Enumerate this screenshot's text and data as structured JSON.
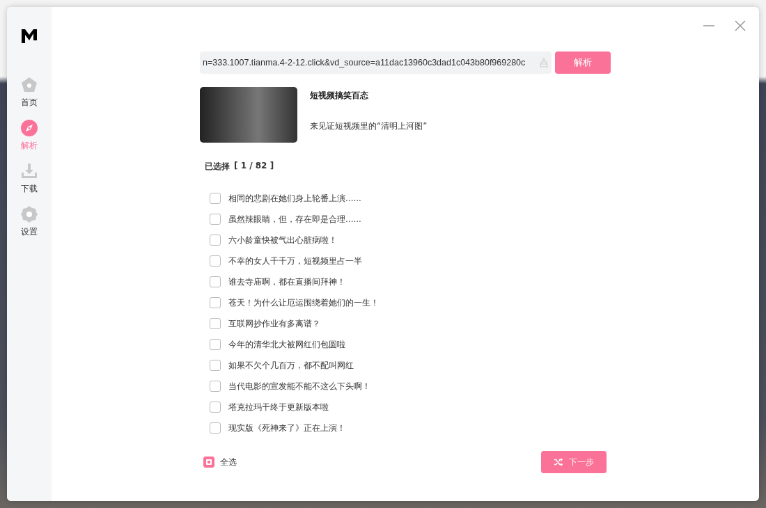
{
  "sidebar": {
    "items": [
      {
        "label": "首页",
        "kind": "home",
        "selected": false
      },
      {
        "label": "解析",
        "kind": "compass",
        "selected": true
      },
      {
        "label": "下载",
        "kind": "download",
        "selected": false
      },
      {
        "label": "设置",
        "kind": "gear",
        "selected": false
      }
    ]
  },
  "url_field": {
    "value": "n=333.1007.tianma.4-2-12.click&vd_source=a11dac13960c3dad1c043b80f969280c"
  },
  "parse_button": "解析",
  "video": {
    "title": "短视频搞笑百态",
    "description": "来见证短视频里的“清明上河图”"
  },
  "selection": {
    "label": "已选择",
    "count": "[ 1 / 82 ]"
  },
  "episodes": [
    {
      "title": "相同的悲剧在她们身上轮番上演......",
      "checked": false
    },
    {
      "title": "虽然辣眼睛，但，存在即是合理......",
      "checked": false
    },
    {
      "title": "六小龄童快被气出心脏病啦！",
      "checked": false
    },
    {
      "title": "不幸的女人千千万，短视频里占一半",
      "checked": false
    },
    {
      "title": "谁去寺庙啊，都在直播间拜神！",
      "checked": false
    },
    {
      "title": "苍天！为什么让厄运围绕着她们的一生！",
      "checked": false
    },
    {
      "title": "互联网抄作业有多离谱？",
      "checked": false
    },
    {
      "title": "今年的清华北大被网红们包圆啦",
      "checked": false
    },
    {
      "title": "如果不欠个几百万，都不配叫网红",
      "checked": false
    },
    {
      "title": "当代电影的宣发能不能不这么下头啊！",
      "checked": false
    },
    {
      "title": "塔克拉玛干终于更新版本啦",
      "checked": false
    },
    {
      "title": "现实版《死神来了》正在上演！",
      "checked": false
    }
  ],
  "select_all": {
    "label": "全选",
    "indeterminate": true
  },
  "next_button": "下一步"
}
